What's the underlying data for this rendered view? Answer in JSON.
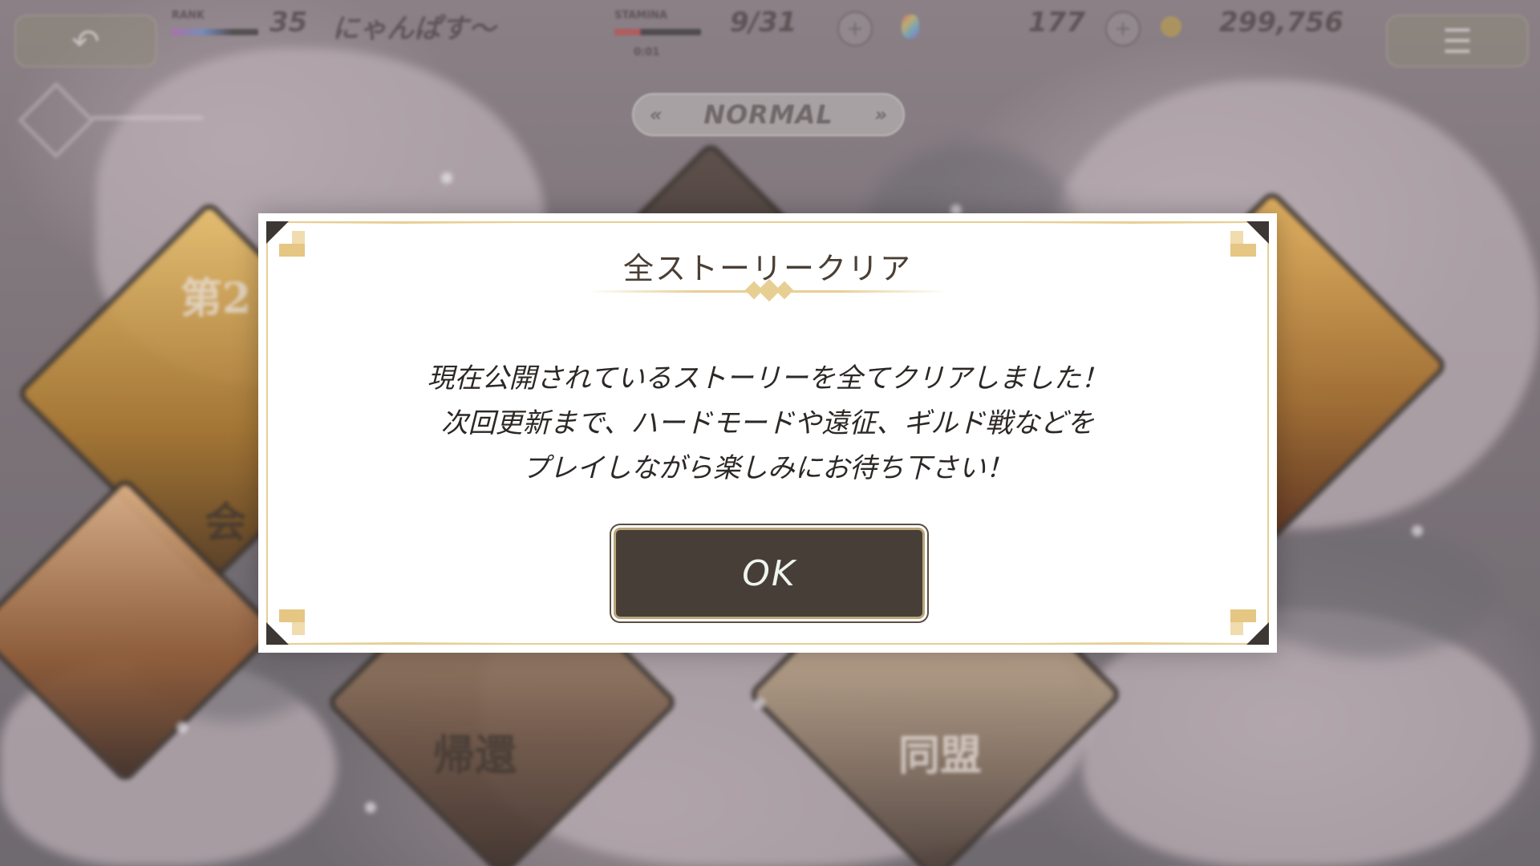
{
  "hud": {
    "back_icon": "back-arrow-icon",
    "rank_label": "RANK",
    "rank_value": "35",
    "player_name": "にゃんぱす～",
    "stamina_label": "STAMINA",
    "stamina_value": "9/31",
    "stamina_timer": "0:01",
    "gems": "177",
    "coins": "299,756",
    "menu_icon": "hamburger-menu-icon",
    "plus_icon": "plus-icon"
  },
  "mode_selector": {
    "label": "NORMAL",
    "prev_icon": "«",
    "next_icon": "»"
  },
  "map_cards": {
    "card_1_label": "第2",
    "card_2_label": "会",
    "card_3_label": "帰還",
    "card_4_label": "同盟"
  },
  "dialog": {
    "title": "全ストーリークリア",
    "message_lines": [
      "現在公開されているストーリーを全てクリアしました！",
      "次回更新まで、ハードモードや遠征、ギルド戦などを",
      "プレイしながら楽しみにお待ち下さい！"
    ],
    "ok_label": "OK"
  },
  "colors": {
    "dialog_bg": "#ffffff",
    "gold_accent": "#e7cf94",
    "button_bg": "#473e37",
    "button_text": "#eef4ee",
    "overlay_tint": "#7d7377"
  }
}
